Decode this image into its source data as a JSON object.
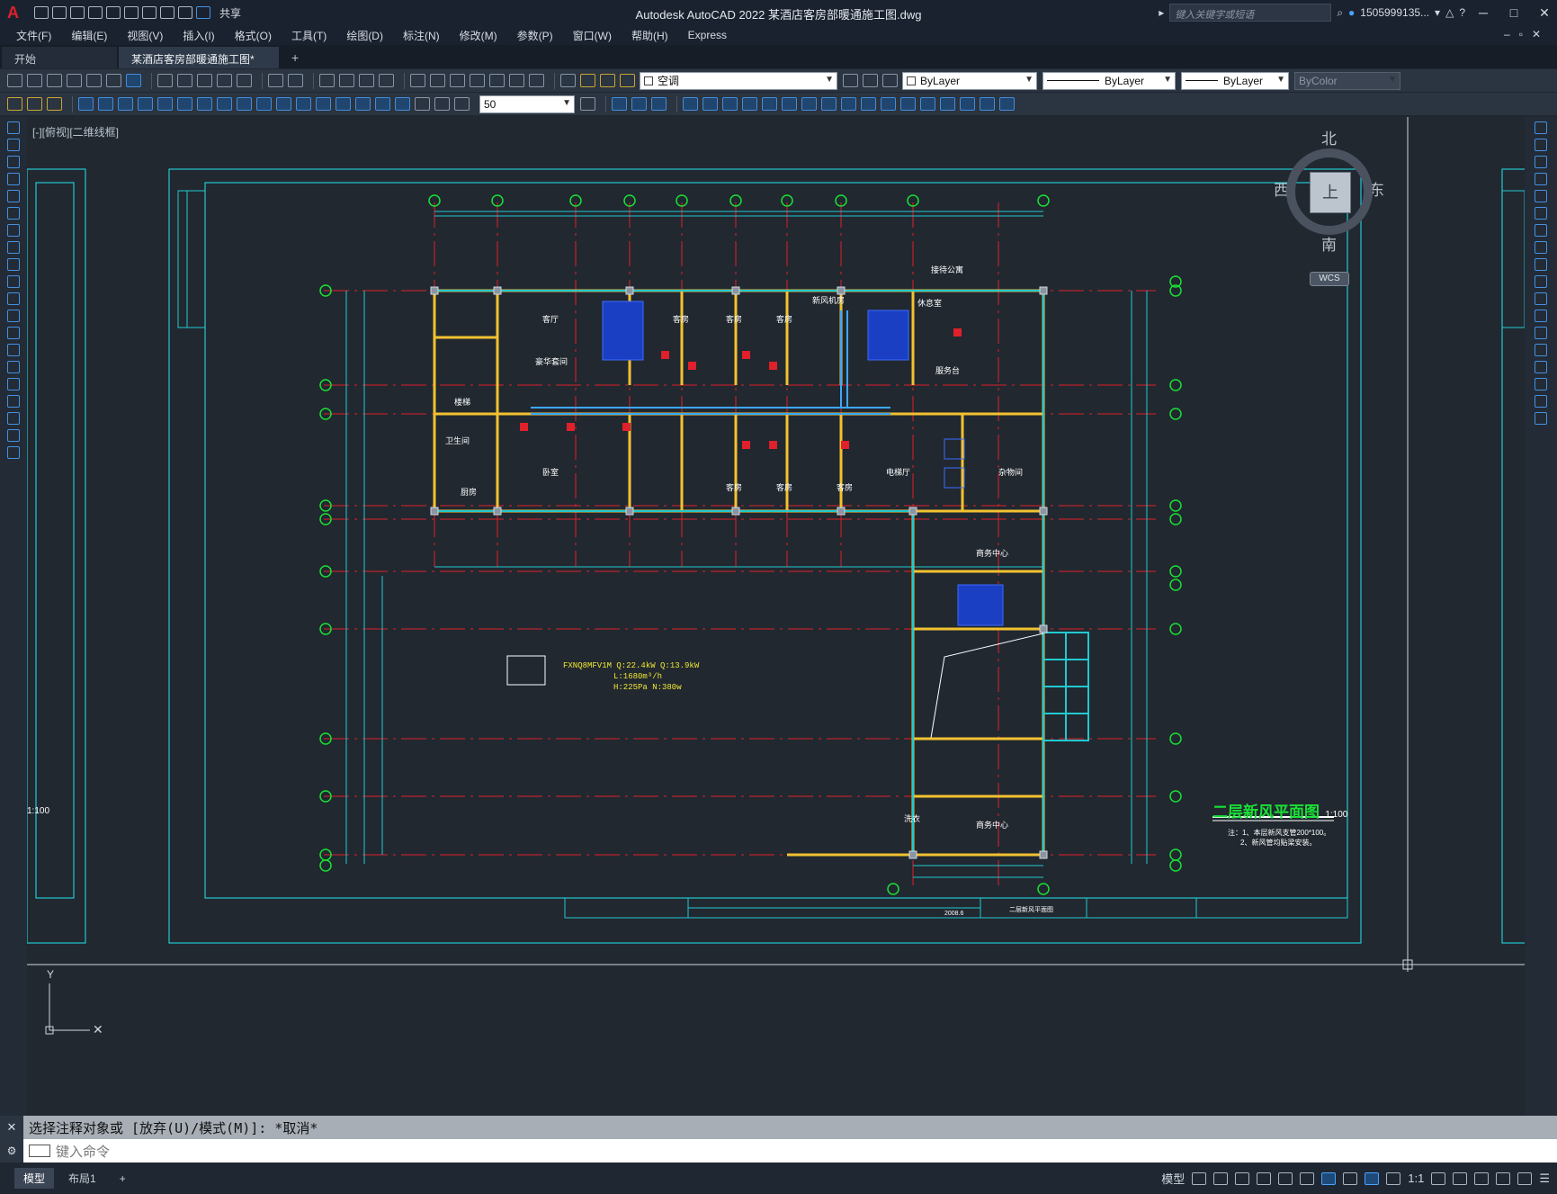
{
  "app": {
    "title": "Autodesk AutoCAD 2022    某酒店客房部暖通施工图.dwg",
    "search_placeholder": "键入关键字或短语",
    "user": "1505999135...",
    "share_label": "共享"
  },
  "menu": [
    "文件(F)",
    "编辑(E)",
    "视图(V)",
    "插入(I)",
    "格式(O)",
    "工具(T)",
    "绘图(D)",
    "标注(N)",
    "修改(M)",
    "参数(P)",
    "窗口(W)",
    "帮助(H)",
    "Express"
  ],
  "tabs": {
    "start": "开始",
    "active": "某酒店客房部暖通施工图*",
    "close": "×",
    "plus": "+"
  },
  "toolbar": {
    "layer": "空调",
    "color": "ByLayer",
    "linetype": "ByLayer",
    "lineweight": "ByLayer",
    "plotstyle": "ByColor",
    "scale": "50"
  },
  "viewport": {
    "label": "[-][俯视][二维线框]",
    "compass": {
      "n": "北",
      "s": "南",
      "e": "东",
      "w": "西",
      "face": "上"
    },
    "wcs": "WCS"
  },
  "drawing": {
    "title": "二层新风平面图",
    "scale": "1:100",
    "left_scale": "1:100",
    "notes": [
      "注：1、本层新风支管200*100。",
      "2、新风管均贴梁安装。"
    ],
    "equipment": [
      "FXNQ8MFV1M   Q:22.4kW   Q:13.9kW",
      "L:1680m³/h",
      "H:225Pa   N:380w"
    ],
    "rooms": [
      {
        "label": "客厅"
      },
      {
        "label": "客房"
      },
      {
        "label": "客房"
      },
      {
        "label": "客房"
      },
      {
        "label": "新风机房"
      },
      {
        "label": "休息室"
      },
      {
        "label": "服务台"
      },
      {
        "label": "豪华套间"
      },
      {
        "label": "楼梯"
      },
      {
        "label": "卫生间"
      },
      {
        "label": "厨房"
      },
      {
        "label": "卧室"
      },
      {
        "label": "客房"
      },
      {
        "label": "客房"
      },
      {
        "label": "客房"
      },
      {
        "label": "电梯厅"
      },
      {
        "label": "杂物间"
      },
      {
        "label": "商务中心"
      },
      {
        "label": "商务中心"
      },
      {
        "label": "接待公寓"
      },
      {
        "label": "洗衣"
      }
    ],
    "title_block": {
      "name": "二层新风平面图",
      "date": "2008.6"
    }
  },
  "command": {
    "history": "选择注释对象或 [放弃(U)/模式(M)]: *取消*",
    "placeholder": "键入命令"
  },
  "status": {
    "model_tab": "模型",
    "layout_tab": "布局1",
    "plus": "+",
    "model_btn": "模型",
    "anno_scale": "1:1"
  }
}
